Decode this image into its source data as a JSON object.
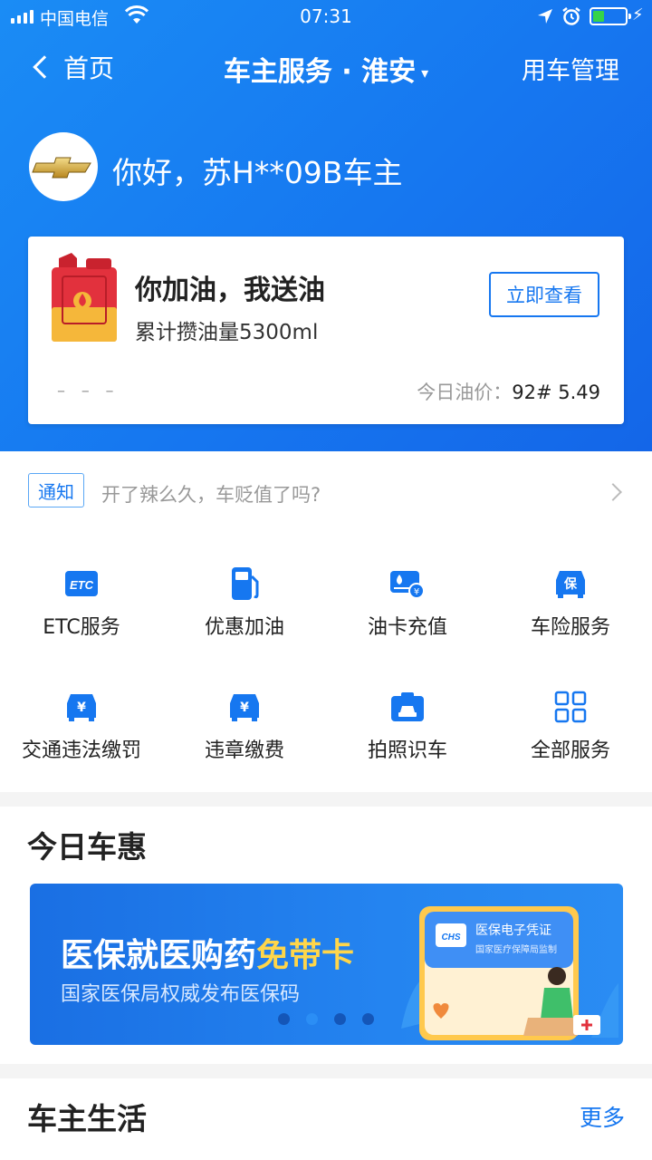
{
  "status_bar": {
    "carrier": "中国电信",
    "time": "07:31"
  },
  "nav": {
    "back_label": "首页",
    "title": "车主服务 · 淮安",
    "title_caret": "▾",
    "right_label": "用车管理"
  },
  "user": {
    "greeting": "你好，苏H**09B车主"
  },
  "fuel_card": {
    "headline": "你加油，我送油",
    "subtitle": "累计攒油量5300ml",
    "button_label": "立即查看",
    "dashes": "– – –",
    "price_label": "今日油价：",
    "price_value": "92# 5.49"
  },
  "notice": {
    "tag": "通知",
    "text": "开了辣么久，车贬值了吗?"
  },
  "services": [
    {
      "label": "ETC服务",
      "icon": "etc-icon"
    },
    {
      "label": "优惠加油",
      "icon": "fuel-pump-icon"
    },
    {
      "label": "油卡充值",
      "icon": "fuel-card-icon"
    },
    {
      "label": "车险服务",
      "icon": "car-insurance-icon"
    },
    {
      "label": "交通违法缴罚",
      "icon": "traffic-fine-icon"
    },
    {
      "label": "违章缴费",
      "icon": "violation-payment-icon"
    },
    {
      "label": "拍照识车",
      "icon": "camera-car-icon"
    },
    {
      "label": "全部服务",
      "icon": "grid-icon"
    }
  ],
  "today_deals": {
    "title": "今日车惠",
    "banner": {
      "line1_a": "医保就医购药",
      "line1_b": "免带卡",
      "line2": "国家医保局权威发布医保码",
      "card_title": "医保电子凭证",
      "card_sub": "国家医疗保障局监制",
      "card_logo": "CHS",
      "active_slide": 2,
      "slide_count": 4
    }
  },
  "car_life": {
    "title": "车主生活",
    "more_label": "更多"
  },
  "colors": {
    "brand_blue": "#1677f0",
    "highlight_yellow": "#ffd64a"
  }
}
